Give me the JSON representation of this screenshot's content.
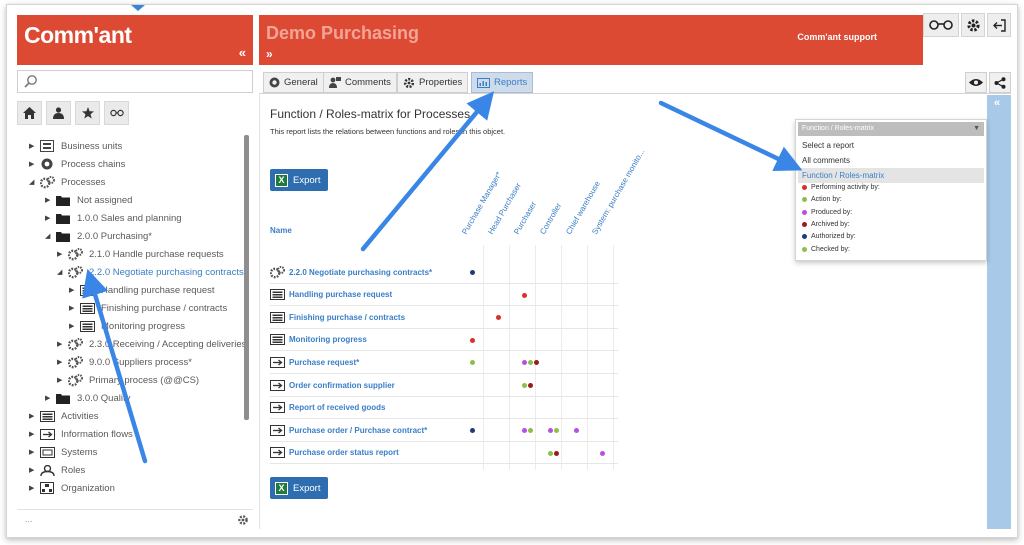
{
  "app": {
    "logo": "Comm'ant",
    "collapse_label": "«",
    "expand_label": "»",
    "title": "Demo Purchasing",
    "support_label": "Comm'ant support"
  },
  "search": {
    "placeholder": ""
  },
  "tree": {
    "items": [
      {
        "label": "Business units",
        "icon": "business-unit-icon",
        "level": 0,
        "toggle": "▶"
      },
      {
        "label": "Process chains",
        "icon": "process-chain-icon",
        "level": 0,
        "toggle": "▶"
      },
      {
        "label": "Processes",
        "icon": "process-icon",
        "level": 0,
        "toggle": "◢"
      },
      {
        "label": "Not assigned",
        "icon": "folder-icon",
        "level": 1,
        "toggle": "▶"
      },
      {
        "label": "1.0.0 Sales and planning",
        "icon": "folder-icon",
        "level": 1,
        "toggle": "▶"
      },
      {
        "label": "2.0.0 Purchasing*",
        "icon": "folder-icon",
        "level": 1,
        "toggle": "◢"
      },
      {
        "label": "2.1.0 Handle purchase requests",
        "icon": "process-icon",
        "level": 2,
        "toggle": "▶"
      },
      {
        "label": "2.2.0 Negotiate purchasing contracts*",
        "icon": "process-icon",
        "level": 2,
        "toggle": "◢",
        "selected": true
      },
      {
        "label": "Handling purchase request",
        "icon": "activity-icon",
        "level": 3,
        "toggle": "▶"
      },
      {
        "label": "Finishing purchase / contracts",
        "icon": "activity-icon",
        "level": 3,
        "toggle": "▶"
      },
      {
        "label": "Monitoring progress",
        "icon": "activity-icon",
        "level": 3,
        "toggle": "▶"
      },
      {
        "label": "2.3.0 Receiving / Accepting deliveries",
        "icon": "process-icon",
        "level": 2,
        "toggle": "▶"
      },
      {
        "label": "9.0.0 Suppliers process*",
        "icon": "process-icon",
        "level": 2,
        "toggle": "▶"
      },
      {
        "label": "Primary process (@@CS)",
        "icon": "process-icon",
        "level": 2,
        "toggle": "▶"
      },
      {
        "label": "3.0.0 Quality",
        "icon": "folder-icon",
        "level": 1,
        "toggle": "▶"
      },
      {
        "label": "Activities",
        "icon": "activity-icon",
        "level": 0,
        "toggle": "▶"
      },
      {
        "label": "Information flows",
        "icon": "information-flow-icon",
        "level": 0,
        "toggle": "▶"
      },
      {
        "label": "Systems",
        "icon": "system-icon",
        "level": 0,
        "toggle": "▶"
      },
      {
        "label": "Roles",
        "icon": "role-icon",
        "level": 0,
        "toggle": "▶"
      },
      {
        "label": "Organization",
        "icon": "organization-icon",
        "level": 0,
        "toggle": "▶"
      }
    ],
    "footer_dots": "..."
  },
  "tabs": [
    {
      "label": "General",
      "icon": "general-icon"
    },
    {
      "label": "Comments",
      "icon": "comments-icon"
    },
    {
      "label": "Properties",
      "icon": "properties-icon"
    },
    {
      "label": "Reports",
      "icon": "reports-icon",
      "active": true
    }
  ],
  "report": {
    "title": "Function / Roles-matrix for Processes",
    "description": "This report lists the relations between functions and roles in this objcet.",
    "export_label": "Export",
    "name_header": "Name",
    "columns": [
      "Purchase Manager*",
      "Head Purchaser",
      "Purchaser",
      "Controller",
      "Chief warehouse",
      "System: purchase monito..."
    ],
    "rows": [
      {
        "label": "2.2.0 Negotiate purchasing contracts*",
        "icon": "process-icon",
        "dots": [
          [
            0,
            "#1f3b7a"
          ]
        ]
      },
      {
        "label": "Handling purchase request",
        "icon": "activity-icon",
        "dots": [
          [
            2,
            "#d9302a"
          ]
        ]
      },
      {
        "label": "Finishing purchase / contracts",
        "icon": "activity-icon",
        "dots": [
          [
            1,
            "#d9302a"
          ]
        ]
      },
      {
        "label": "Monitoring progress",
        "icon": "activity-icon",
        "dots": [
          [
            0,
            "#d9302a"
          ]
        ]
      },
      {
        "label": "Purchase request*",
        "icon": "information-flow-icon",
        "dots": [
          [
            0,
            "#8ac04a"
          ],
          [
            2,
            "#b94ee0"
          ],
          [
            2,
            "#8ac04a"
          ],
          [
            2,
            "#9b1b1b"
          ]
        ]
      },
      {
        "label": "Order confirmation supplier",
        "icon": "information-flow-icon",
        "dots": [
          [
            2,
            "#8ac04a"
          ],
          [
            2,
            "#9b1b1b"
          ]
        ]
      },
      {
        "label": "Report of received goods",
        "icon": "information-flow-icon",
        "dots": []
      },
      {
        "label": "Purchase order / Purchase contract*",
        "icon": "information-flow-icon",
        "dots": [
          [
            0,
            "#1f3b7a"
          ],
          [
            2,
            "#b94ee0"
          ],
          [
            2,
            "#8ac04a"
          ],
          [
            3,
            "#b94ee0"
          ],
          [
            3,
            "#8ac04a"
          ],
          [
            4,
            "#b94ee0"
          ]
        ]
      },
      {
        "label": "Purchase order status report",
        "icon": "information-flow-icon",
        "dots": [
          [
            3,
            "#8ac04a"
          ],
          [
            3,
            "#9b1b1b"
          ],
          [
            5,
            "#b94ee0"
          ]
        ]
      }
    ]
  },
  "dropdown": {
    "selected": "Function / Roles-matrix",
    "caret": "▼",
    "options": [
      "Select a report",
      "All comments",
      "Function / Roles-matrix"
    ],
    "highlighted_index": 2,
    "legend": [
      {
        "label": "Performing activity by:",
        "color": "#d9302a"
      },
      {
        "label": "Action by:",
        "color": "#8ac04a"
      },
      {
        "label": "Produced by:",
        "color": "#b94ee0"
      },
      {
        "label": "Archived by:",
        "color": "#9b1b1b"
      },
      {
        "label": "Authorized by:",
        "color": "#1f3b7a"
      },
      {
        "label": "Checked by:",
        "color": "#8ac04a"
      }
    ]
  },
  "colors": {
    "header_red": "#dd4a33",
    "link_blue": "#3a7ec7",
    "arrow_blue": "#3a86e6"
  }
}
